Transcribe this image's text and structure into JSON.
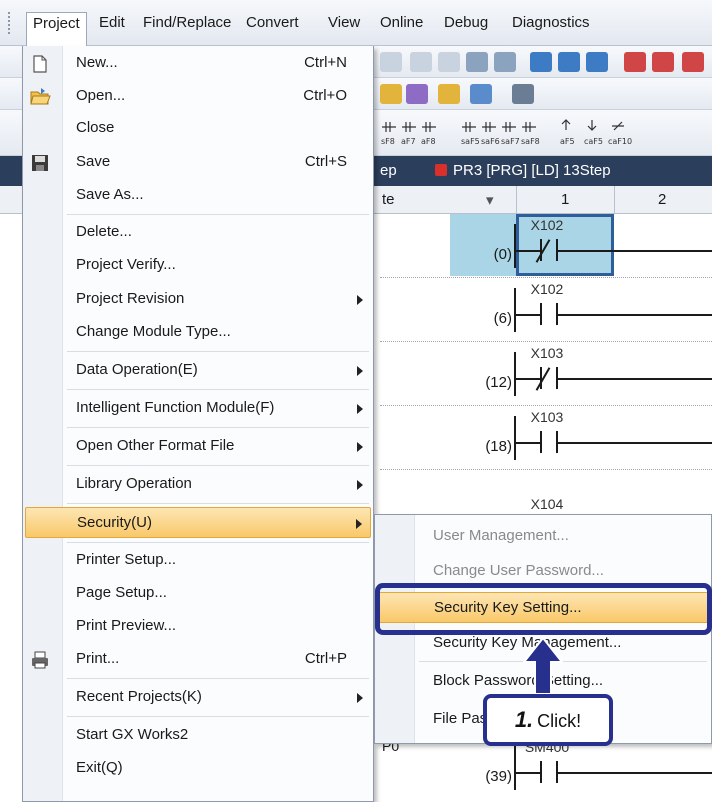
{
  "menubar": {
    "items": [
      "Project",
      "Edit",
      "Find/Replace",
      "Convert",
      "View",
      "Online",
      "Debug",
      "Diagnostics"
    ]
  },
  "editor": {
    "tabs": [
      "ep",
      "PR3 [PRG] [LD] 13Step"
    ],
    "column_header": {
      "left": "te",
      "dropdown": "▾",
      "col1": "1",
      "col2": "2"
    },
    "rungs": [
      {
        "step": "(0)",
        "device": "X102",
        "contact": "nc",
        "selected": true
      },
      {
        "step": "(6)",
        "device": "X102",
        "contact": "no",
        "selected": false
      },
      {
        "step": "(12)",
        "device": "X103",
        "contact": "nc",
        "selected": false
      },
      {
        "step": "(18)",
        "device": "X103",
        "contact": "no",
        "selected": false
      },
      {
        "step": "",
        "device": "X104",
        "contact": "",
        "selected": false
      },
      {
        "step": "(39)",
        "device": "SM400",
        "contact": "no",
        "selected": false,
        "left_label": "P0"
      }
    ]
  },
  "project_menu": {
    "items": [
      {
        "label": "New...",
        "shortcut": "Ctrl+N",
        "icon": "new-file-icon"
      },
      {
        "label": "Open...",
        "shortcut": "Ctrl+O",
        "icon": "open-folder-icon"
      },
      {
        "label": "Close",
        "shortcut": ""
      },
      {
        "label": "Save",
        "shortcut": "Ctrl+S",
        "icon": "save-disk-icon"
      },
      {
        "label": "Save As...",
        "shortcut": ""
      },
      {
        "label": "Delete...",
        "shortcut": ""
      },
      {
        "label": "Project Verify...",
        "shortcut": ""
      },
      {
        "label": "Project Revision",
        "shortcut": "",
        "submenu": true
      },
      {
        "label": "Change Module Type...",
        "shortcut": ""
      },
      {
        "label": "Data Operation(E)",
        "shortcut": "",
        "submenu": true
      },
      {
        "label": "Intelligent Function Module(F)",
        "shortcut": "",
        "submenu": true
      },
      {
        "label": "Open Other Format File",
        "shortcut": "",
        "submenu": true
      },
      {
        "label": "Library Operation",
        "shortcut": "",
        "submenu": true
      },
      {
        "label": "Security(U)",
        "shortcut": "",
        "submenu": true,
        "active": true
      },
      {
        "label": "Printer Setup...",
        "shortcut": ""
      },
      {
        "label": "Page Setup...",
        "shortcut": ""
      },
      {
        "label": "Print Preview...",
        "shortcut": ""
      },
      {
        "label": "Print...",
        "shortcut": "Ctrl+P",
        "icon": "printer-icon"
      },
      {
        "label": "Recent Projects(K)",
        "shortcut": "",
        "submenu": true
      },
      {
        "label": "Start GX Works2",
        "shortcut": ""
      },
      {
        "label": "Exit(Q)",
        "shortcut": ""
      }
    ]
  },
  "security_submenu": {
    "items": [
      {
        "label": "User Management...",
        "disabled": true
      },
      {
        "label": "Change User Password...",
        "disabled": true
      },
      {
        "label": "Security Key Setting...",
        "active": true
      },
      {
        "label": "Security Key Management..."
      },
      {
        "label": "Block Password Setting..."
      },
      {
        "label": "File Password Setting..."
      }
    ]
  },
  "callout": {
    "step": "1.",
    "text": "Click!"
  },
  "colors": {
    "highlight_border": "#27308c",
    "menu_active": "#f9c869",
    "tab_bar": "#2b3e5c",
    "cursor": "#2e5e9a"
  }
}
